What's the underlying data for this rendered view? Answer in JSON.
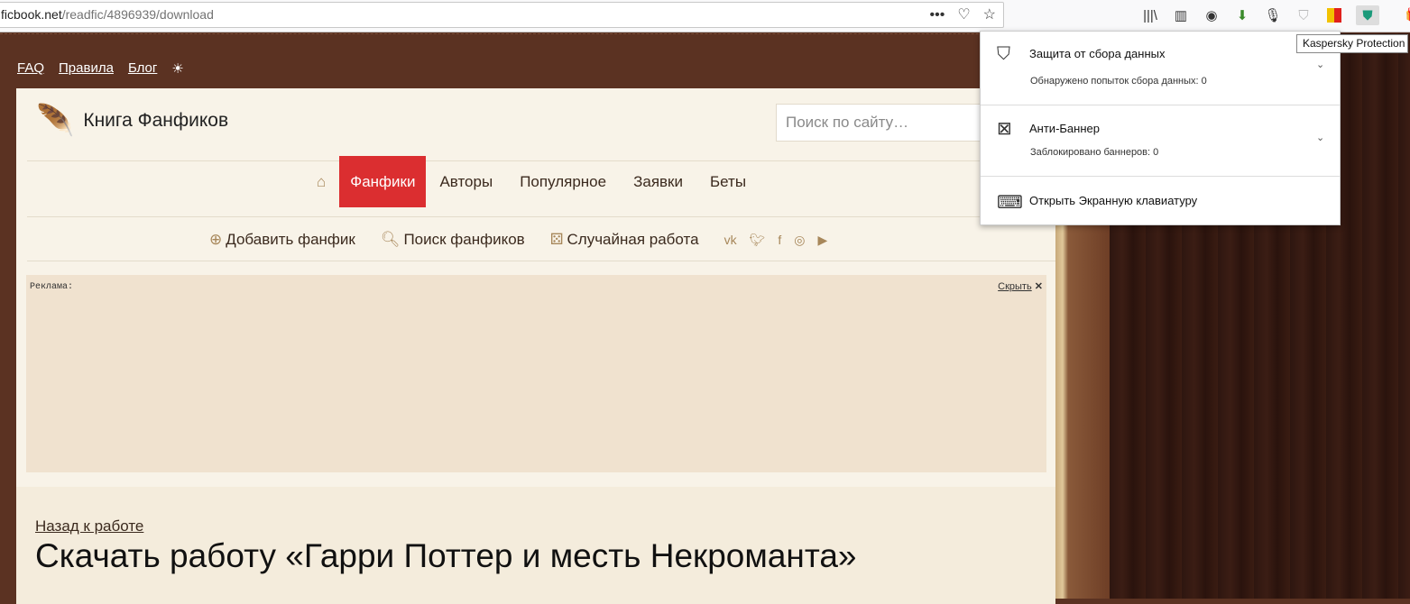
{
  "browser": {
    "url_host": "ficbook.net",
    "url_path": "/readfic/4896939/download",
    "tooltip": "Kaspersky Protection"
  },
  "site": {
    "top_links": [
      "FAQ",
      "Правила",
      "Блог"
    ],
    "logo": "Книга Фанфиков",
    "search_placeholder": "Поиск по сайту…",
    "nav": [
      "Фанфики",
      "Авторы",
      "Популярное",
      "Заявки",
      "Беты"
    ],
    "sub": {
      "add": "Добавить фанфик",
      "search": "Поиск фанфиков",
      "random": "Случайная работа"
    },
    "ad": {
      "label": "Реклама:",
      "hide": "Скрыть"
    },
    "back": "Назад к работе",
    "heading": "Скачать работу «Гарри Поттер и месть Некроманта»"
  },
  "kaspersky": {
    "data_protection": {
      "title": "Защита от сбора данных",
      "desc": "Обнаружено попыток сбора данных: 0"
    },
    "anti_banner": {
      "title": "Анти-Баннер",
      "desc": "Заблокировано баннеров: 0"
    },
    "keyboard": {
      "title": "Открыть Экранную клавиатуру"
    }
  }
}
